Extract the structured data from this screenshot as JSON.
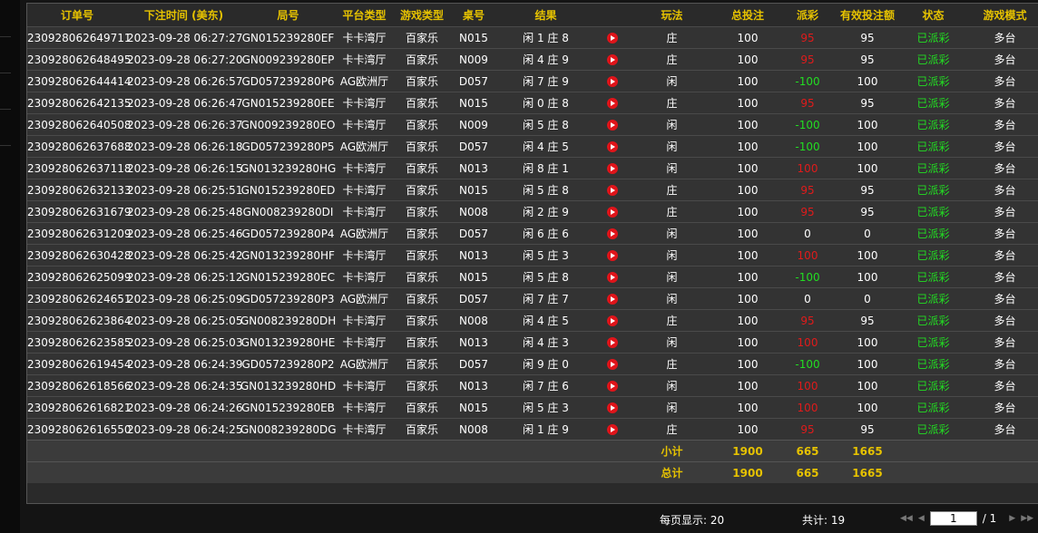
{
  "columns": [
    "订单号",
    "下注时间 (美东)",
    "局号",
    "平台类型",
    "游戏类型",
    "桌号",
    "结果",
    "",
    "玩法",
    "总投注",
    "派彩",
    "有效投注额",
    "状态",
    "游戏模式"
  ],
  "rows": [
    {
      "order": "230928062649711",
      "time": "2023-09-28 06:27:27",
      "round": "GN015239280EF",
      "platform": "卡卡湾厅",
      "game": "百家乐",
      "table": "N015",
      "result": "闲 1 庄 8",
      "bet_type": "庄",
      "total": "100",
      "payout": "95",
      "payout_color": "red",
      "valid": "95",
      "status": "已派彩",
      "mode": "多台"
    },
    {
      "order": "230928062648495",
      "time": "2023-09-28 06:27:20",
      "round": "GN009239280EP",
      "platform": "卡卡湾厅",
      "game": "百家乐",
      "table": "N009",
      "result": "闲 4 庄 9",
      "bet_type": "庄",
      "total": "100",
      "payout": "95",
      "payout_color": "red",
      "valid": "95",
      "status": "已派彩",
      "mode": "多台"
    },
    {
      "order": "230928062644414",
      "time": "2023-09-28 06:26:57",
      "round": "GD057239280P6",
      "platform": "AG欧洲厅",
      "game": "百家乐",
      "table": "D057",
      "result": "闲 7 庄 9",
      "bet_type": "闲",
      "total": "100",
      "payout": "-100",
      "payout_color": "green",
      "valid": "100",
      "status": "已派彩",
      "mode": "多台"
    },
    {
      "order": "230928062642135",
      "time": "2023-09-28 06:26:47",
      "round": "GN015239280EE",
      "platform": "卡卡湾厅",
      "game": "百家乐",
      "table": "N015",
      "result": "闲 0 庄 8",
      "bet_type": "庄",
      "total": "100",
      "payout": "95",
      "payout_color": "red",
      "valid": "95",
      "status": "已派彩",
      "mode": "多台"
    },
    {
      "order": "230928062640508",
      "time": "2023-09-28 06:26:37",
      "round": "GN009239280EO",
      "platform": "卡卡湾厅",
      "game": "百家乐",
      "table": "N009",
      "result": "闲 5 庄 8",
      "bet_type": "闲",
      "total": "100",
      "payout": "-100",
      "payout_color": "green",
      "valid": "100",
      "status": "已派彩",
      "mode": "多台"
    },
    {
      "order": "230928062637688",
      "time": "2023-09-28 06:26:18",
      "round": "GD057239280P5",
      "platform": "AG欧洲厅",
      "game": "百家乐",
      "table": "D057",
      "result": "闲 4 庄 5",
      "bet_type": "闲",
      "total": "100",
      "payout": "-100",
      "payout_color": "green",
      "valid": "100",
      "status": "已派彩",
      "mode": "多台"
    },
    {
      "order": "230928062637118",
      "time": "2023-09-28 06:26:15",
      "round": "GN013239280HG",
      "platform": "卡卡湾厅",
      "game": "百家乐",
      "table": "N013",
      "result": "闲 8 庄 1",
      "bet_type": "闲",
      "total": "100",
      "payout": "100",
      "payout_color": "red",
      "valid": "100",
      "status": "已派彩",
      "mode": "多台"
    },
    {
      "order": "230928062632133",
      "time": "2023-09-28 06:25:51",
      "round": "GN015239280ED",
      "platform": "卡卡湾厅",
      "game": "百家乐",
      "table": "N015",
      "result": "闲 5 庄 8",
      "bet_type": "庄",
      "total": "100",
      "payout": "95",
      "payout_color": "red",
      "valid": "95",
      "status": "已派彩",
      "mode": "多台"
    },
    {
      "order": "230928062631679",
      "time": "2023-09-28 06:25:48",
      "round": "GN008239280DI",
      "platform": "卡卡湾厅",
      "game": "百家乐",
      "table": "N008",
      "result": "闲 2 庄 9",
      "bet_type": "庄",
      "total": "100",
      "payout": "95",
      "payout_color": "red",
      "valid": "95",
      "status": "已派彩",
      "mode": "多台"
    },
    {
      "order": "230928062631209",
      "time": "2023-09-28 06:25:46",
      "round": "GD057239280P4",
      "platform": "AG欧洲厅",
      "game": "百家乐",
      "table": "D057",
      "result": "闲 6 庄 6",
      "bet_type": "闲",
      "total": "100",
      "payout": "0",
      "payout_color": "white",
      "valid": "0",
      "status": "已派彩",
      "mode": "多台"
    },
    {
      "order": "230928062630428",
      "time": "2023-09-28 06:25:42",
      "round": "GN013239280HF",
      "platform": "卡卡湾厅",
      "game": "百家乐",
      "table": "N013",
      "result": "闲 5 庄 3",
      "bet_type": "闲",
      "total": "100",
      "payout": "100",
      "payout_color": "red",
      "valid": "100",
      "status": "已派彩",
      "mode": "多台"
    },
    {
      "order": "230928062625099",
      "time": "2023-09-28 06:25:12",
      "round": "GN015239280EC",
      "platform": "卡卡湾厅",
      "game": "百家乐",
      "table": "N015",
      "result": "闲 5 庄 8",
      "bet_type": "闲",
      "total": "100",
      "payout": "-100",
      "payout_color": "green",
      "valid": "100",
      "status": "已派彩",
      "mode": "多台"
    },
    {
      "order": "230928062624651",
      "time": "2023-09-28 06:25:09",
      "round": "GD057239280P3",
      "platform": "AG欧洲厅",
      "game": "百家乐",
      "table": "D057",
      "result": "闲 7 庄 7",
      "bet_type": "闲",
      "total": "100",
      "payout": "0",
      "payout_color": "white",
      "valid": "0",
      "status": "已派彩",
      "mode": "多台"
    },
    {
      "order": "230928062623864",
      "time": "2023-09-28 06:25:05",
      "round": "GN008239280DH",
      "platform": "卡卡湾厅",
      "game": "百家乐",
      "table": "N008",
      "result": "闲 4 庄 5",
      "bet_type": "庄",
      "total": "100",
      "payout": "95",
      "payout_color": "red",
      "valid": "95",
      "status": "已派彩",
      "mode": "多台"
    },
    {
      "order": "230928062623585",
      "time": "2023-09-28 06:25:03",
      "round": "GN013239280HE",
      "platform": "卡卡湾厅",
      "game": "百家乐",
      "table": "N013",
      "result": "闲 4 庄 3",
      "bet_type": "闲",
      "total": "100",
      "payout": "100",
      "payout_color": "red",
      "valid": "100",
      "status": "已派彩",
      "mode": "多台"
    },
    {
      "order": "230928062619454",
      "time": "2023-09-28 06:24:39",
      "round": "GD057239280P2",
      "platform": "AG欧洲厅",
      "game": "百家乐",
      "table": "D057",
      "result": "闲 9 庄 0",
      "bet_type": "庄",
      "total": "100",
      "payout": "-100",
      "payout_color": "green",
      "valid": "100",
      "status": "已派彩",
      "mode": "多台"
    },
    {
      "order": "230928062618566",
      "time": "2023-09-28 06:24:35",
      "round": "GN013239280HD",
      "platform": "卡卡湾厅",
      "game": "百家乐",
      "table": "N013",
      "result": "闲 7 庄 6",
      "bet_type": "闲",
      "total": "100",
      "payout": "100",
      "payout_color": "red",
      "valid": "100",
      "status": "已派彩",
      "mode": "多台"
    },
    {
      "order": "230928062616821",
      "time": "2023-09-28 06:24:26",
      "round": "GN015239280EB",
      "platform": "卡卡湾厅",
      "game": "百家乐",
      "table": "N015",
      "result": "闲 5 庄 3",
      "bet_type": "闲",
      "total": "100",
      "payout": "100",
      "payout_color": "red",
      "valid": "100",
      "status": "已派彩",
      "mode": "多台"
    },
    {
      "order": "230928062616550",
      "time": "2023-09-28 06:24:25",
      "round": "GN008239280DG",
      "platform": "卡卡湾厅",
      "game": "百家乐",
      "table": "N008",
      "result": "闲 1 庄 9",
      "bet_type": "庄",
      "total": "100",
      "payout": "95",
      "payout_color": "red",
      "valid": "95",
      "status": "已派彩",
      "mode": "多台"
    }
  ],
  "subtotal": {
    "label": "小计",
    "total": "1900",
    "payout": "665",
    "valid": "1665"
  },
  "grandtotal": {
    "label": "总计",
    "total": "1900",
    "payout": "665",
    "valid": "1665"
  },
  "footer": {
    "per_page": "每页显示: 20",
    "count": "共计: 19",
    "page_value": "1",
    "page_total": "/  1"
  },
  "colors": {
    "header": "#e6c200",
    "red": "#e01b1b",
    "green": "#22dd22",
    "play": "#e0141a"
  },
  "icons": {
    "result_video": "play-icon",
    "first": "first-page-icon",
    "prev": "prev-page-icon",
    "next": "next-page-icon",
    "last": "last-page-icon"
  }
}
